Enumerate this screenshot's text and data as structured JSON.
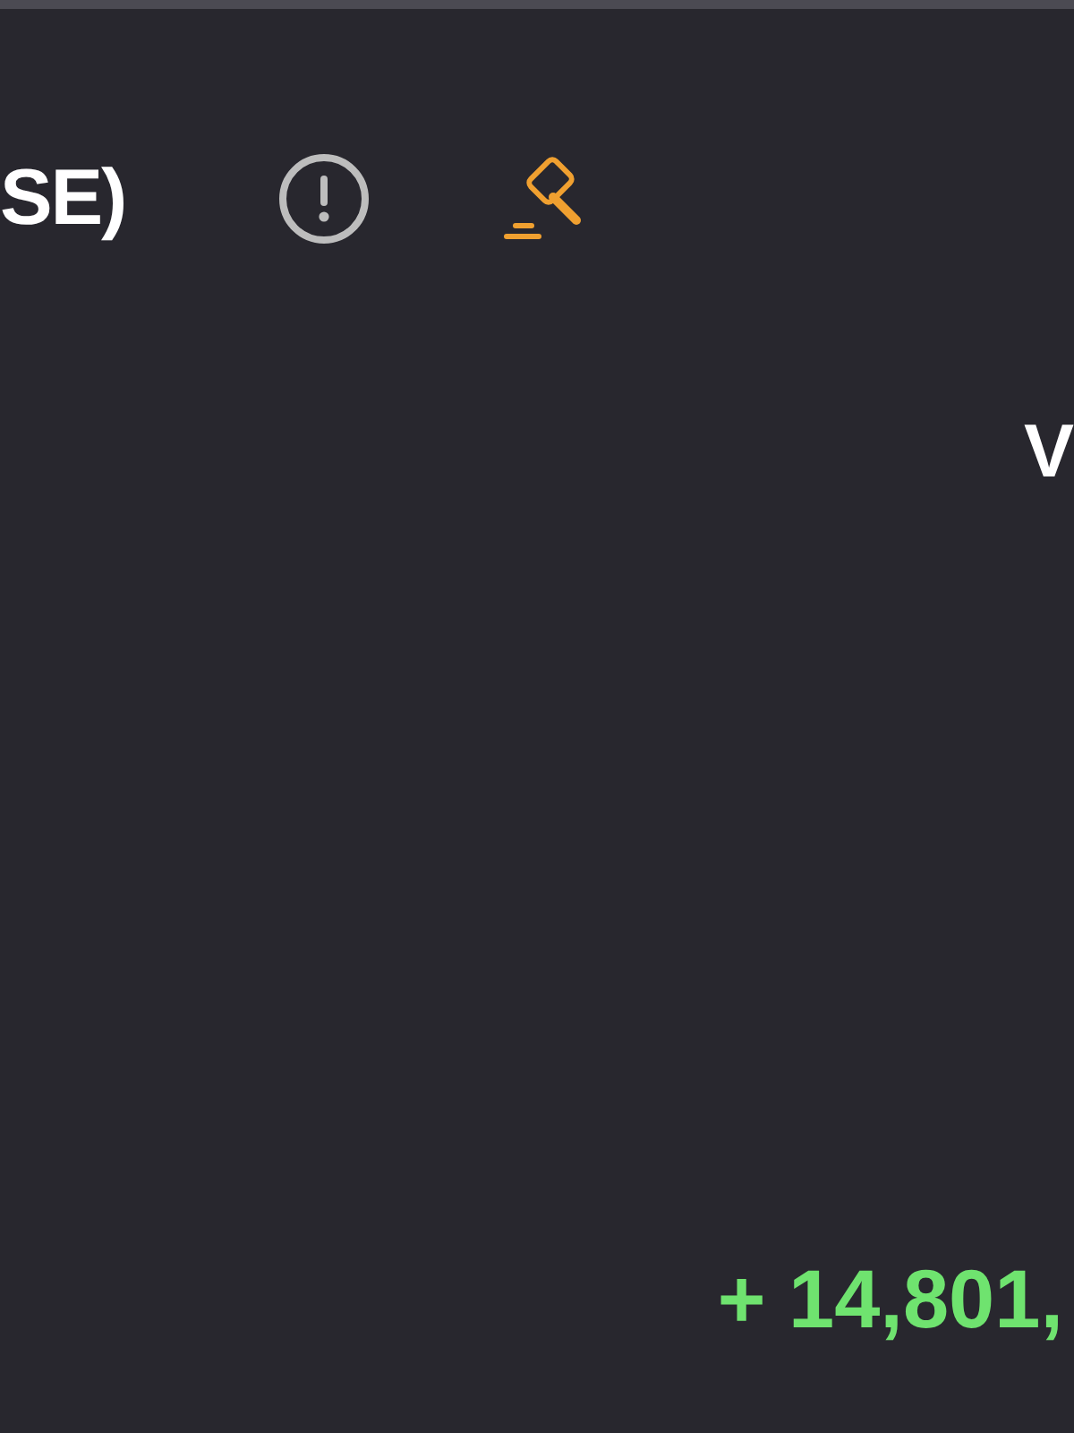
{
  "header": {
    "title": "SE)"
  },
  "column_heading": "V",
  "amount": "+ 14,801,"
}
